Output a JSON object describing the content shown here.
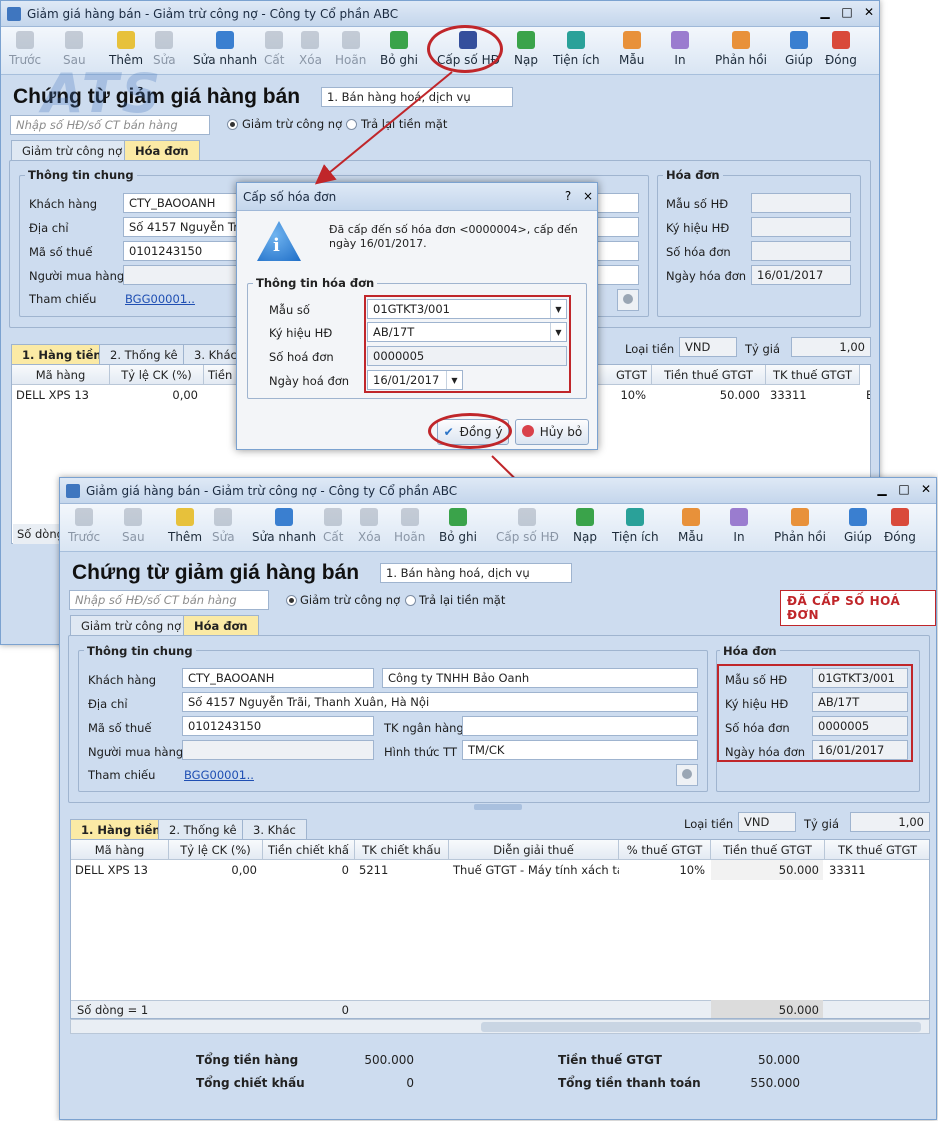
{
  "bg_window": {
    "title": "Giảm giá hàng bán - Giảm trừ công nợ - Công ty Cổ phần ABC",
    "toolbar": [
      "Trước",
      "Sau",
      "Thêm",
      "Sửa",
      "Sửa nhanh",
      "Cất",
      "Xóa",
      "Hoãn",
      "Bỏ ghi",
      "Cấp số HĐ",
      "Nạp",
      "Tiện ích",
      "Mẫu",
      "In",
      "Phản hồi",
      "Giúp",
      "Đóng"
    ],
    "doc_title": "Chứng từ giảm giá hàng bán",
    "doc_type": "1. Bán hàng hoá, dịch vụ",
    "search_placeholder": "Nhập số HĐ/số CT bán hàng",
    "radio1": "Giảm trừ công nợ",
    "radio2": "Trả lại tiền mặt",
    "tab1": "Giảm trừ công nợ",
    "tab2": "Hóa đơn",
    "group_general": "Thông tin chung",
    "lbl_customer": "Khách hàng",
    "customer_code": "CTY_BAOOANH",
    "lbl_address": "Địa chỉ",
    "address": "Số 4157 Nguyễn Trãi,",
    "lbl_tax": "Mã số thuế",
    "tax": "0101243150",
    "lbl_buyer": "Người mua hàng",
    "lbl_ref": "Tham chiếu",
    "ref": "BGG00001",
    "ref_more": "...",
    "group_invoice": "Hóa đơn",
    "lbl_form": "Mẫu số HĐ",
    "lbl_symbol": "Ký hiệu HĐ",
    "lbl_invno": "Số hóa đơn",
    "lbl_invdate": "Ngày hóa đơn",
    "invdate": "16/01/2017",
    "gtab1": "1. Hàng tiền",
    "gtab2": "2. Thống kê",
    "gtab3": "3. Khác",
    "currency_lbl": "Loại tiền",
    "currency": "VND",
    "rate_lbl": "Tỷ giá",
    "rate": "1,00",
    "cols": [
      "Mã hàng",
      "Tỷ lệ CK (%)",
      "Tiền c",
      "GTGT",
      "Tiền thuế GTGT",
      "TK thuế GTGT"
    ],
    "row": [
      "DELL XPS 13",
      "0,00",
      "10%",
      "50.000",
      "33311",
      "E"
    ],
    "rowcount": "Số dòng"
  },
  "dialog": {
    "title": "Cấp số hóa đơn",
    "help": "?",
    "close": "×",
    "message": "Đã cấp đến số hóa đơn <0000004>, cấp đến ngày 16/01/2017.",
    "group": "Thông tin hóa đơn",
    "lbl_form": "Mẫu số",
    "form": "01GTKT3/001",
    "lbl_symbol": "Ký hiệu HĐ",
    "symbol": "AB/17T",
    "lbl_no": "Số hoá đơn",
    "no": "0000005",
    "lbl_date": "Ngày hoá đơn",
    "date": "16/01/2017",
    "ok": "Đồng ý",
    "cancel": "Hủy bỏ"
  },
  "fg_window": {
    "title": "Giảm giá hàng bán - Giảm trừ công nợ - Công ty Cổ phần ABC",
    "toolbar": [
      "Trước",
      "Sau",
      "Thêm",
      "Sửa",
      "Sửa nhanh",
      "Cất",
      "Xóa",
      "Hoãn",
      "Bỏ ghi",
      "Cấp số HĐ",
      "Nạp",
      "Tiện ích",
      "Mẫu",
      "In",
      "Phản hồi",
      "Giúp",
      "Đóng"
    ],
    "doc_title": "Chứng từ giảm giá hàng bán",
    "doc_type": "1. Bán hàng hoá, dịch vụ",
    "search_placeholder": "Nhập số HĐ/số CT bán hàng",
    "radio1": "Giảm trừ công nợ",
    "radio2": "Trả lại tiền mặt",
    "stamp": "ĐÃ CẤP SỐ HOÁ ĐƠN",
    "tab1": "Giảm trừ công nợ",
    "tab2": "Hóa đơn",
    "group_general": "Thông tin chung",
    "lbl_customer": "Khách hàng",
    "customer_code": "CTY_BAOOANH",
    "customer_name": "Công ty TNHH Bảo Oanh",
    "lbl_address": "Địa chỉ",
    "address": "Số 4157 Nguyễn Trãi, Thanh Xuân, Hà Nội",
    "lbl_tax": "Mã số thuế",
    "tax": "0101243150",
    "lbl_bank": "TK ngân hàng",
    "lbl_buyer": "Người mua hàng",
    "lbl_paymethod": "Hình thức TT",
    "paymethod": "TM/CK",
    "lbl_ref": "Tham chiếu",
    "ref": "BGG00001",
    "ref_more": "...",
    "group_invoice": "Hóa đơn",
    "lbl_form": "Mẫu số HĐ",
    "form": "01GTKT3/001",
    "lbl_symbol": "Ký hiệu HĐ",
    "symbol": "AB/17T",
    "lbl_invno": "Số hóa đơn",
    "invno": "0000005",
    "lbl_invdate": "Ngày hóa đơn",
    "invdate": "16/01/2017",
    "gtab1": "1. Hàng tiền",
    "gtab2": "2. Thống kê",
    "gtab3": "3. Khác",
    "currency_lbl": "Loại tiền",
    "currency": "VND",
    "rate_lbl": "Tỷ giá",
    "rate": "1,00",
    "cols": [
      "Mã hàng",
      "Tỷ lệ CK (%)",
      "Tiền chiết khấ",
      "TK chiết khấu",
      "Diễn giải thuế",
      "% thuế GTGT",
      "Tiền thuế GTGT",
      "TK thuế GTGT"
    ],
    "row": [
      "DELL XPS 13",
      "0,00",
      "0",
      "5211",
      "Thuế GTGT - Máy tính xách tay",
      "10%",
      "50.000",
      "33311"
    ],
    "rowcount": "Số dòng = 1",
    "sum_discount": "0",
    "sum_tax": "50.000",
    "total_goods_lbl": "Tổng tiền hàng",
    "total_goods": "500.000",
    "total_discount_lbl": "Tổng chiết khấu",
    "total_discount": "0",
    "total_tax_lbl": "Tiền thuế GTGT",
    "total_tax": "50.000",
    "total_pay_lbl": "Tổng tiền thanh toán",
    "total_pay": "550.000"
  },
  "colors": {
    "accent_red": "#c0262a",
    "window_bg": "#cddcef",
    "tab_active": "#fbeaa5"
  }
}
